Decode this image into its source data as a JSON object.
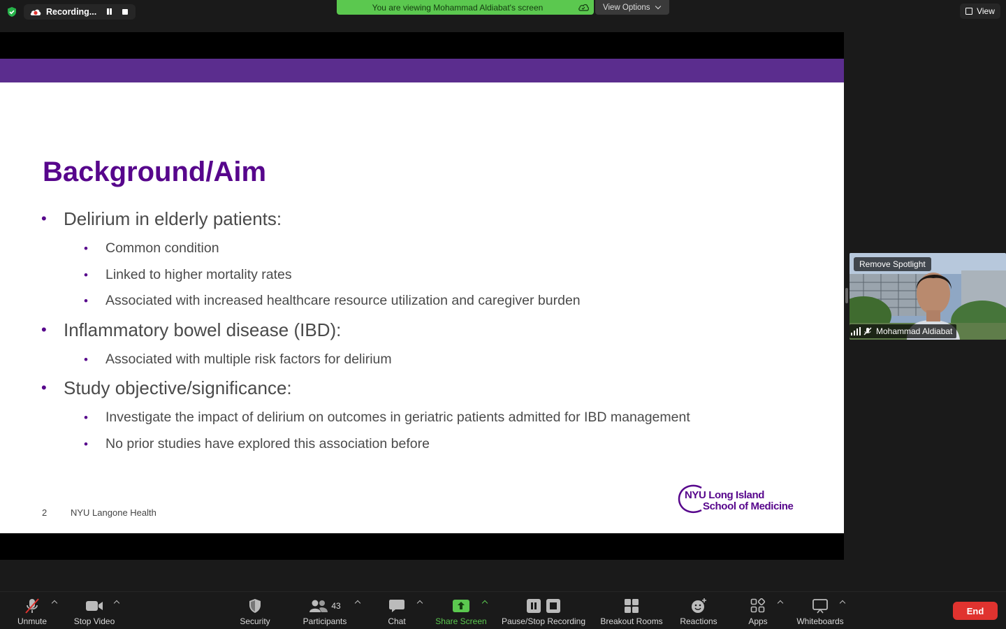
{
  "top_bar": {
    "recording_label": "Recording...",
    "viewing_banner": "You are viewing Mohammad Aldiabat's screen",
    "view_options_label": "View Options",
    "view_label": "View"
  },
  "slide": {
    "title": "Background/Aim",
    "bullets": [
      {
        "text": "Delirium in elderly patients:",
        "subs": [
          "Common condition",
          "Linked to higher mortality rates",
          "Associated with increased healthcare resource utilization and caregiver burden"
        ]
      },
      {
        "text": "Inflammatory bowel disease (IBD):",
        "subs": [
          "Associated with multiple risk factors for delirium"
        ]
      },
      {
        "text": "Study objective/significance:",
        "subs": [
          "Investigate the impact of delirium on outcomes in geriatric patients admitted for IBD management",
          "No prior studies have explored this association before"
        ]
      }
    ],
    "bullet_glyph": "•",
    "page_number": "2",
    "footer": "NYU Langone Health",
    "logo_line1": "NYU Long Island",
    "logo_line2": "School of Medicine"
  },
  "video": {
    "remove_spotlight_label": "Remove Spotlight",
    "participant_name": "Mohammad Aldiabat"
  },
  "toolbar": {
    "unmute": "Unmute",
    "stop_video": "Stop Video",
    "security": "Security",
    "participants": "Participants",
    "participants_count": "43",
    "chat": "Chat",
    "share_screen": "Share Screen",
    "pause_stop_recording": "Pause/Stop Recording",
    "breakout_rooms": "Breakout Rooms",
    "reactions": "Reactions",
    "apps": "Apps",
    "whiteboards": "Whiteboards",
    "end": "End"
  },
  "colors": {
    "accent_purple": "#57068c",
    "banner_green": "#5bc84f",
    "end_red": "#e0332f"
  }
}
